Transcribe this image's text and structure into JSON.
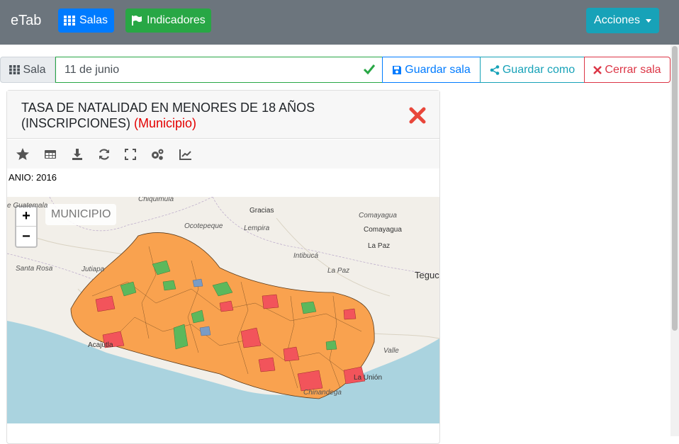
{
  "navbar": {
    "brand": "eTab",
    "salas_label": "Salas",
    "indicadores_label": "Indicadores",
    "acciones_label": "Acciones"
  },
  "sala_bar": {
    "label": "Sala",
    "name_value": "11 de junio",
    "guardar_label": "Guardar sala",
    "guardar_como_label": "Guardar como",
    "cerrar_label": "Cerrar sala"
  },
  "card": {
    "title": "TASA DE NATALIDAD EN MENORES DE 18 AÑOS (INSCRIPCIONES)",
    "level": "(Municipio)",
    "filter_text": "ANIO: 2016",
    "icons": [
      "star-icon",
      "table-icon",
      "download-icon",
      "refresh-icon",
      "fullscreen-icon",
      "settings-icon",
      "chart-line-icon"
    ]
  },
  "map": {
    "zoom_in": "+",
    "zoom_out": "−",
    "layer_label": "MUNICIPIO",
    "places": [
      "Chiquimula",
      "Gracias",
      "Comayagua",
      "Comayagua",
      "Ocotepeque",
      "Lempira",
      "La Paz",
      "Intibucá",
      "La Paz",
      "Santa Rosa",
      "Jutiapa",
      "Tegucigalpa",
      "Acajutla",
      "Valle",
      "Chinandega",
      "La Unión",
      "e Guatemala"
    ]
  },
  "colors": {
    "navbar": "#6c757d",
    "primary": "#007bff",
    "success": "#28a745",
    "info": "#17a2b8",
    "danger": "#dc3545",
    "map_orange": "#f9a24f",
    "map_green": "#5cb85c",
    "map_red": "#f2545b"
  }
}
